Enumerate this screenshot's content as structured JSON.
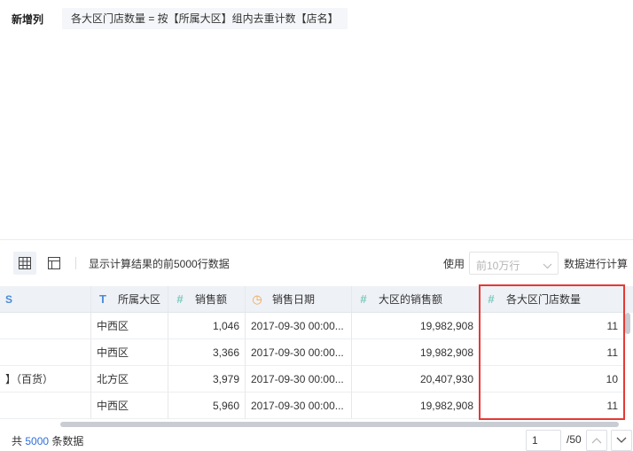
{
  "formula": {
    "label": "新增列",
    "expression": "各大区门店数量 = 按【所属大区】组内去重计数【店名】"
  },
  "toolbar": {
    "result_text": "显示计算结果的前5000行数据",
    "use_label": "使用",
    "range_value": "前10万行",
    "calc_label": "数据进行计算",
    "icons": [
      "grid-view-icon",
      "table-view-icon",
      "chevron-down-icon"
    ]
  },
  "table": {
    "first_col_fragment": "S",
    "columns": [
      {
        "type_icon": "text-type-icon",
        "glyph": "T",
        "label": "所属大区"
      },
      {
        "type_icon": "number-type-icon",
        "glyph": "#",
        "label": "销售额"
      },
      {
        "type_icon": "date-type-icon",
        "glyph": "◷",
        "label": "销售日期"
      },
      {
        "type_icon": "number-type-icon",
        "glyph": "#",
        "label": "大区的销售额"
      },
      {
        "type_icon": "number-type-icon",
        "glyph": "#",
        "label": "各大区门店数量"
      }
    ],
    "rows": [
      {
        "c0": "",
        "region": "中西区",
        "sales": "1,046",
        "date": "2017-09-30 00:00...",
        "region_sales": "19,982,908",
        "store_count": "11"
      },
      {
        "c0": "",
        "region": "中西区",
        "sales": "3,366",
        "date": "2017-09-30 00:00...",
        "region_sales": "19,982,908",
        "store_count": "11"
      },
      {
        "c0": "】（百货）",
        "region": "北方区",
        "sales": "3,979",
        "date": "2017-09-30 00:00...",
        "region_sales": "20,407,930",
        "store_count": "10"
      },
      {
        "c0": "",
        "region": "中西区",
        "sales": "5,960",
        "date": "2017-09-30 00:00...",
        "region_sales": "19,982,908",
        "store_count": "11"
      }
    ],
    "highlight_color": "#e53935"
  },
  "footer": {
    "total_prefix": "共",
    "total_count": "5000",
    "total_suffix": "条数据",
    "page_value": "1",
    "page_total": "/50"
  },
  "colors": {
    "accent": "#2f6fd6",
    "number_icon": "#7ac9bd",
    "text_icon": "#4a8bd8",
    "date_icon": "#f0a44a"
  }
}
